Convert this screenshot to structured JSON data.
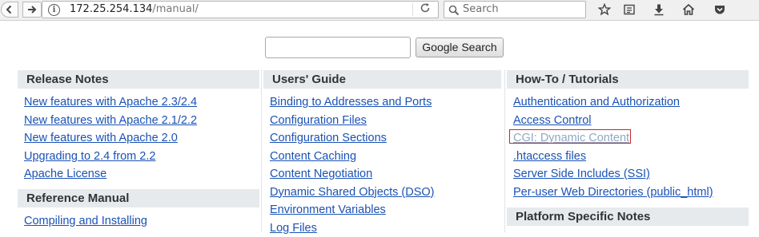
{
  "browser": {
    "url_host": "172.25.254.134",
    "url_path": "/manual/",
    "search_placeholder": "Search",
    "icons": [
      "back-arrow-icon",
      "forward-arrow-icon",
      "info-icon",
      "reload-icon",
      "search-icon",
      "star-icon",
      "reading-list-icon",
      "download-icon",
      "home-icon",
      "pocket-icon"
    ]
  },
  "google": {
    "query": "",
    "button_label": "Google Search"
  },
  "columns": {
    "release_notes": {
      "title": "Release Notes",
      "links": [
        "New features with Apache 2.3/2.4",
        "New features with Apache 2.1/2.2",
        "New features with Apache 2.0",
        "Upgrading to 2.4 from 2.2",
        "Apache License"
      ]
    },
    "reference_manual": {
      "title": "Reference Manual",
      "links": [
        "Compiling and Installing"
      ]
    },
    "users_guide": {
      "title": "Users' Guide",
      "links": [
        "Binding to Addresses and Ports",
        "Configuration Files",
        "Configuration Sections",
        "Content Caching",
        "Content Negotiation",
        "Dynamic Shared Objects (DSO)",
        "Environment Variables",
        "Log Files"
      ]
    },
    "howto": {
      "title": "How-To / Tutorials",
      "links": [
        "Authentication and Authorization",
        "Access Control",
        "CGI: Dynamic Content",
        ".htaccess files",
        "Server Side Includes (SSI)",
        "Per-user Web Directories (public_html)"
      ]
    },
    "platform_notes": {
      "title": "Platform Specific Notes"
    }
  },
  "colors": {
    "link": "#1a52b5",
    "visited_link": "#8fa8c3",
    "section_header_bg": "#e6eaed",
    "focus_outline": "#c62828"
  }
}
